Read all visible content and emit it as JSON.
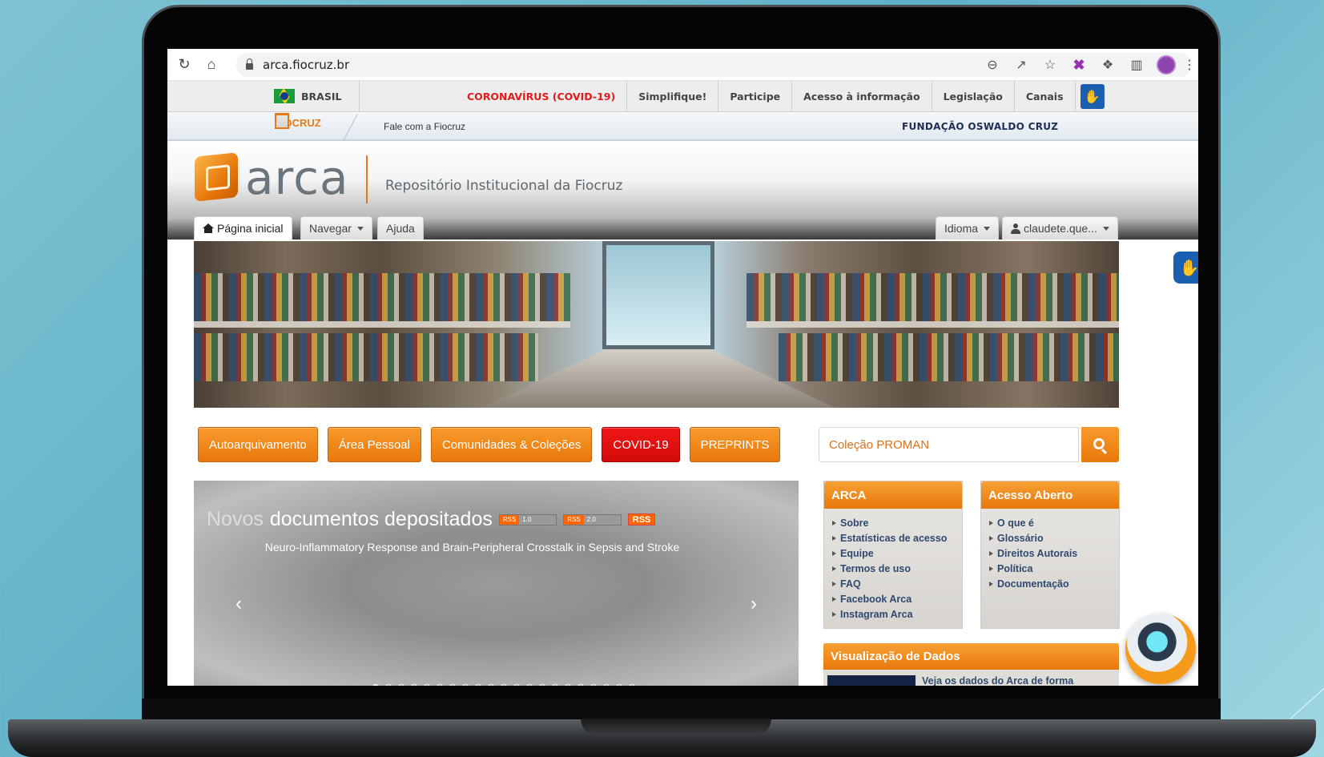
{
  "browser": {
    "url": "arca.fiocruz.br",
    "icons": [
      "reload-icon",
      "home-icon",
      "lock-icon",
      "zoom-out-icon",
      "share-icon",
      "star-icon",
      "extension-x-icon",
      "puzzle-icon",
      "sidepanel-icon",
      "profile-icon"
    ]
  },
  "govbar": {
    "brasil": "BRASIL",
    "links": [
      "CORONAVÍRUS (COVID-19)",
      "Simplifique!",
      "Participe",
      "Acesso à informação",
      "Legislação",
      "Canais"
    ]
  },
  "fiocruz_bar": {
    "logo": "FIOCRUZ",
    "contact": "Fale com a Fiocruz",
    "foundation": "FUNDAÇÃO OSWALDO CRUZ"
  },
  "header": {
    "logo_word": "arca",
    "subtitle": "Repositório Institucional da Fiocruz",
    "nav": {
      "home": "Página inicial",
      "browse": "Navegar",
      "help": "Ajuda",
      "language": "Idioma",
      "user": "claudete.que..."
    }
  },
  "actions": {
    "buttons": [
      "Autoarquivamento",
      "Área Pessoal",
      "Comunidades & Coleções",
      "COVID-19",
      "PREPRINTS"
    ],
    "search_value": "Coleção PROMAN"
  },
  "carousel": {
    "title_prefix": "Novos",
    "title_rest": "documentos depositados",
    "rss1": [
      "RSS",
      "1.0"
    ],
    "rss2": [
      "RSS",
      "2.0"
    ],
    "rss3": "RSS",
    "item": "Neuro-Inflammatory Response and Brain-Peripheral Crosstalk in Sepsis and Stroke",
    "prev": "‹",
    "next": "›",
    "dot_count": 21,
    "active_dot": 0
  },
  "arca_box": {
    "title": "ARCA",
    "items": [
      "Sobre",
      "Estatísticas de acesso",
      "Equipe",
      "Termos de uso",
      "FAQ",
      "Facebook Arca",
      "Instagram Arca"
    ]
  },
  "open_access_box": {
    "title": "Acesso Aberto",
    "items": [
      "O que é",
      "Glossário",
      "Direitos Autorais",
      "Política",
      "Documentação"
    ]
  },
  "data_viz": {
    "title": "Visualização de Dados",
    "text": "Veja os dados do Arca de forma"
  },
  "colors": {
    "accent": "#e8780c",
    "covid": "#d30b0b",
    "link": "#2f4a6e"
  }
}
